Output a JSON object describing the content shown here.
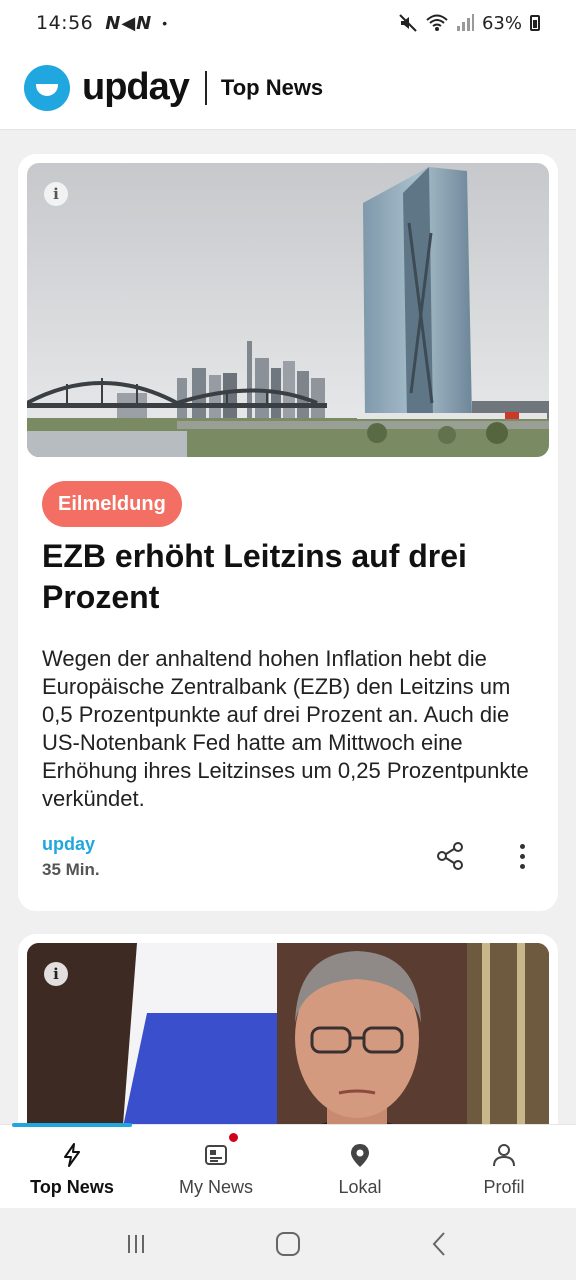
{
  "status_bar": {
    "time": "14:56",
    "carriers": "N◀N",
    "dot": "•",
    "battery": "63%",
    "icons": [
      "mute-icon",
      "wifi-icon",
      "signal-icon",
      "battery-icon"
    ]
  },
  "header": {
    "brand": "upday",
    "section": "Top News",
    "brand_color": "#21a7e0"
  },
  "feed": {
    "articles": [
      {
        "badge": "Eilmeldung",
        "badge_color": "#f36f63",
        "headline": "EZB erhöht Leitzins auf drei Prozent",
        "summary": "Wegen der anhaltend hohen Inflation hebt die Europäische Zentralbank (EZB) den Leitzins um 0,5 Prozentpunkte auf drei Prozent an. Auch die US-Notenbank Fed hatte am Mittwoch eine Erhöhung ihres Leitzinses um 0,25 Prozentpunkte verkündet.",
        "source": "upday",
        "age": "35 Min.",
        "image": "ECB tower with Frankfurt skyline and river bridge",
        "info_symbol": "i"
      },
      {
        "image": "Man in front of a white-blue-red flag",
        "info_symbol": "i"
      }
    ]
  },
  "bottom_nav": {
    "items": [
      {
        "label": "Top News",
        "icon": "lightning-icon",
        "active": true
      },
      {
        "label": "My News",
        "icon": "news-icon",
        "active": false,
        "has_notification": true
      },
      {
        "label": "Lokal",
        "icon": "location-pin-icon",
        "active": false
      },
      {
        "label": "Profil",
        "icon": "person-icon",
        "active": false
      }
    ]
  },
  "system_nav": [
    "recent-apps-icon",
    "home-icon",
    "back-icon"
  ]
}
